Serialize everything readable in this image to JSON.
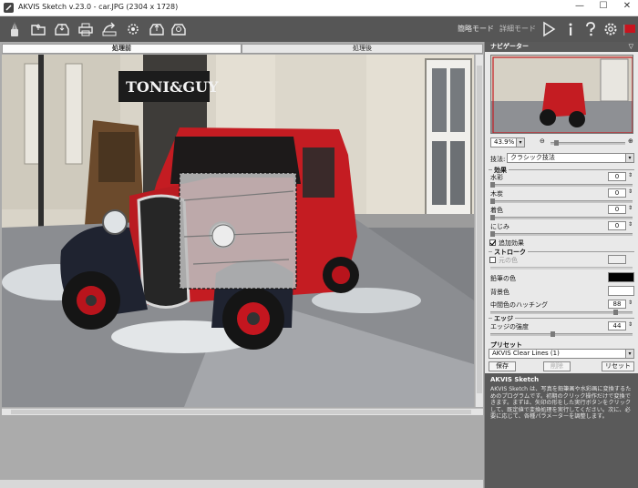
{
  "window": {
    "title": "AKVIS Sketch v.23.0 - car.JPG (2304 x 1728)"
  },
  "toolbar": {
    "modes": {
      "express": "簡略モード",
      "advanced": "詳細モード"
    },
    "icons": [
      "app-logo-icon",
      "open-icon",
      "save-icon",
      "print-icon",
      "share-icon",
      "settings-batch-icon",
      "before-icon",
      "after-icon",
      "play-icon",
      "info-icon",
      "help-icon",
      "preferences-icon",
      "flag-icon"
    ]
  },
  "tabs": {
    "before": "処理前",
    "after": "処理後"
  },
  "navigator": {
    "title": "ナビゲーター",
    "zoom": "43.9%",
    "zoom_minus": "⊖",
    "zoom_plus": "⊕"
  },
  "technique": {
    "label": "技法:",
    "value": "クラシック技法"
  },
  "effects": {
    "section": "効果",
    "rows": [
      {
        "label": "水彩",
        "value": "0"
      },
      {
        "label": "木炭",
        "value": "0"
      },
      {
        "label": "着色",
        "value": "0"
      },
      {
        "label": "にじみ",
        "value": "0"
      }
    ],
    "extra_label": "追加効果"
  },
  "stroke": {
    "section": "ストローク",
    "orig_color_label": "元の色",
    "pencil_color_label": "鉛筆の色",
    "bg_color_label": "背景色",
    "midtone_label": "中間色のハッチング",
    "midtone_value": "88",
    "pencil_color": "#000000",
    "bg_color": "#ffffff"
  },
  "edge": {
    "section": "エッジ",
    "strength_label": "エッジの強度",
    "strength_value": "44"
  },
  "presets": {
    "section": "プリセット",
    "value": "AKVIS Clear Lines (1)",
    "save": "保存",
    "delete": "削除",
    "reset": "リセット"
  },
  "help": {
    "title": "AKVIS Sketch",
    "text": "AKVIS Sketch は、写真を鉛筆画や水彩画に変換するためのプログラムです。初期のクリック操作だけで変換できます。まずは、矢印の形をした実行ボタンをクリックして、既定値で変換処理を実行してください。次に、必要に応じて、各種パラメーターを調整します。"
  },
  "colors": {
    "accent_flag": "#c8141e",
    "toolbar": "#565656",
    "panel_header": "#5a5a5a"
  }
}
